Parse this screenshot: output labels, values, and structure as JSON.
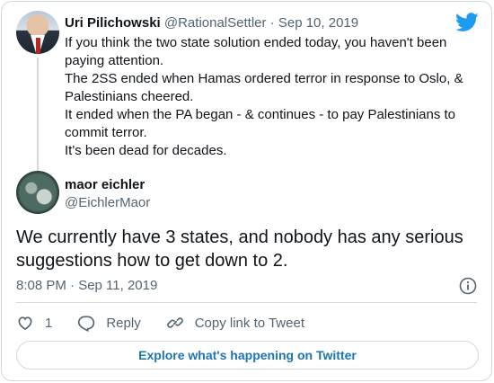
{
  "parent_tweet": {
    "name": "Uri Pilichowski",
    "handle": "@RationalSettler",
    "separator": "·",
    "date": "Sep 10, 2019",
    "lines": [
      "If you think the two state solution ended today, you haven't been paying attention.",
      "The 2SS ended when Hamas ordered terror in response to Oslo, & Palestinians cheered.",
      "It ended when the PA began - & continues - to pay Palestinians to commit terror.",
      "It's been dead for decades."
    ]
  },
  "tweet": {
    "name": "maor eichler",
    "handle": "@EichlerMaor",
    "text": "We currently have 3 states, and nobody has any serious suggestions how to get down to 2.",
    "timestamp": "8:08 PM · Sep 11, 2019"
  },
  "actions": {
    "like_count": "1",
    "reply_label": "Reply",
    "copy_link_label": "Copy link to Tweet"
  },
  "explore_label": "Explore what's happening on Twitter",
  "colors": {
    "twitter_blue": "#1d9bf0",
    "link_blue": "#1d74b4",
    "muted": "#536471",
    "border": "#cfd9de"
  },
  "icons": [
    "twitter-bird-icon",
    "info-icon",
    "heart-icon",
    "reply-bubble-icon",
    "link-icon"
  ]
}
